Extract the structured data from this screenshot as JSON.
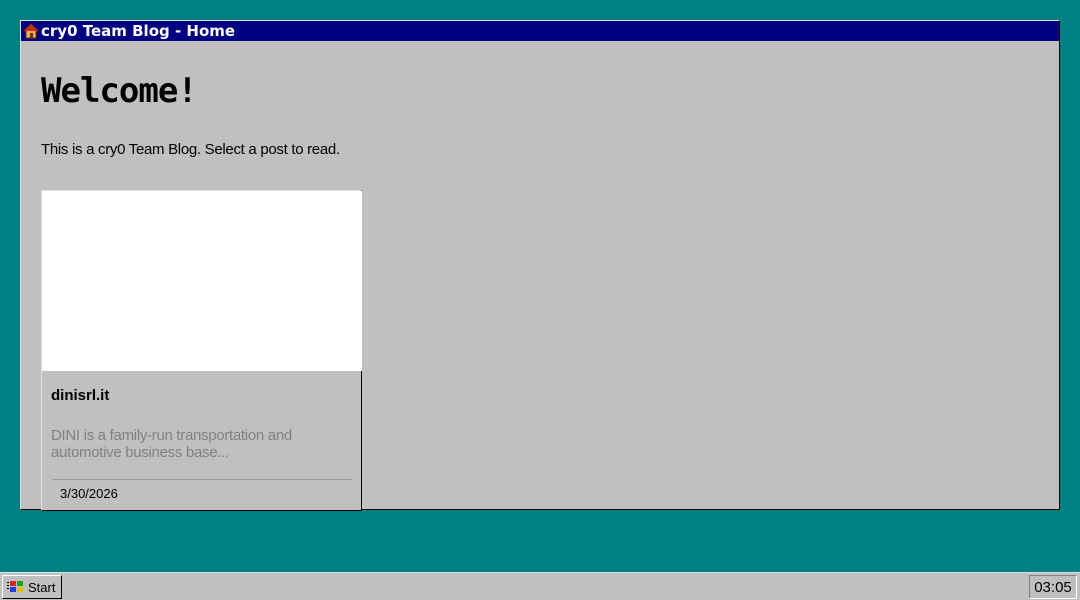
{
  "window": {
    "title": "cry0 Team Blog - Home",
    "icon": "home-icon"
  },
  "page": {
    "heading": "Welcome!",
    "subtitle": "This is a cry0 Team Blog. Select a post to read."
  },
  "posts": [
    {
      "title": "dinisrl.it",
      "excerpt": "DINI is a family-run transportation and automotive business base...",
      "date": "3/30/2026"
    }
  ],
  "taskbar": {
    "start_label": "Start",
    "start_icon": "windows-logo-icon",
    "clock": "03:05"
  },
  "colors": {
    "desktop": "#008080",
    "titlebar": "#000080",
    "window": "#c0c0c0",
    "excerpt_text": "#808080"
  }
}
